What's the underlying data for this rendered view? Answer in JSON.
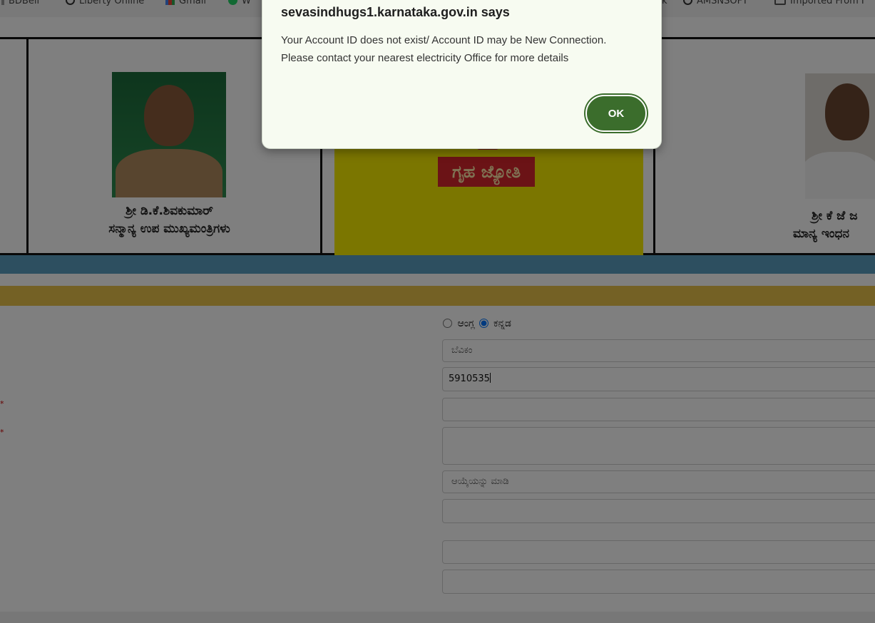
{
  "bookmarks": [
    {
      "icon": "bookmark-icon",
      "label": "BDBell"
    },
    {
      "icon": "globe-icon",
      "label": "Liberty Online"
    },
    {
      "icon": "gmail-icon",
      "label": "Gmail"
    },
    {
      "icon": "whatsapp-icon",
      "label": "W"
    },
    {
      "icon": "globe-icon",
      "label": "k"
    },
    {
      "icon": "globe-icon",
      "label": "AMSNSOFT"
    },
    {
      "icon": "folder-icon",
      "label": "Imported From I"
    }
  ],
  "banner": {
    "left_caption_line1": "ಶ್ರೀ ಡಿ.ಕೆ.ಶಿವಕುಮಾರ್",
    "left_caption_line2": "ಸನ್ಮಾನ್ಯ ಉಪ ಮುಖ್ಯಮಂತ್ರಿಗಳು",
    "logo_text": "ಗೃಹ ಜ್ಯೋತಿ",
    "right_caption_line1": "ಶ್ರೀ ಕೆ ಜೆ ಜ",
    "right_caption_line2": "ಮಾನ್ಯ ಇಂಧನ"
  },
  "form": {
    "language_option_english": "ಆಂಗ್ಲ",
    "language_option_kannada": "ಕನ್ನಡ",
    "selected_language": "kannada",
    "field_escom_value": "ಬೆವಿಕಂ",
    "field_account_id_value": "5910535",
    "field_select_placeholder": "ಆಯ್ಕೆಯನ್ನು ಮಾಡಿ",
    "required_mark": "*"
  },
  "dialog": {
    "title": "sevasindhugs1.karnataka.gov.in says",
    "message_line1": "Your Account ID does not exist/ Account ID may be New Connection.",
    "message_line2": "Please contact your nearest electricity Office for more details",
    "ok_label": "OK"
  },
  "colors": {
    "ok_button": "#3b6d2c",
    "blue_bar": "#5a9fc1",
    "gold_bar": "#e8c24a",
    "logo_bg": "#f7ec00",
    "logo_red": "#d7262c"
  }
}
